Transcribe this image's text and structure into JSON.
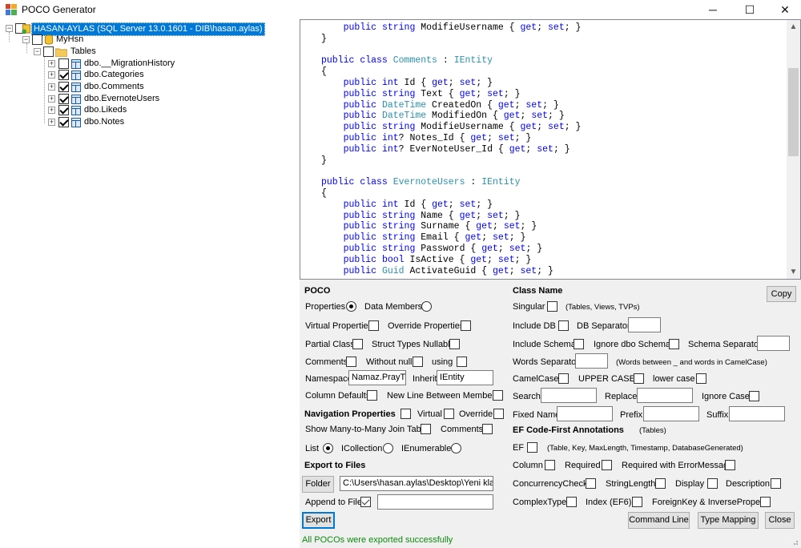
{
  "window": {
    "title": "POCO Generator",
    "minimize": "─",
    "maximize": "☐",
    "close": "✕"
  },
  "tree": {
    "server": "HASAN-AYLAS (SQL Server 13.0.1601 - DIB\\hasan.aylas)",
    "database": "MyHsn",
    "tables_folder": "Tables",
    "tables": [
      {
        "name": "dbo.__MigrationHistory",
        "checked": false
      },
      {
        "name": "dbo.Categories",
        "checked": true
      },
      {
        "name": "dbo.Comments",
        "checked": true
      },
      {
        "name": "dbo.EvernoteUsers",
        "checked": true
      },
      {
        "name": "dbo.Likeds",
        "checked": true
      },
      {
        "name": "dbo.Notes",
        "checked": true
      }
    ]
  },
  "code_lines": [
    {
      "t": [
        [
          "    ",
          ""
        ],
        [
          "public",
          "kw"
        ],
        [
          " ",
          ""
        ],
        [
          "string",
          "kw"
        ],
        [
          " ModifieUsername { ",
          ""
        ],
        [
          "get",
          "kw"
        ],
        [
          "; ",
          ""
        ],
        [
          "set",
          "kw"
        ],
        [
          "; }",
          ""
        ]
      ]
    },
    {
      "t": [
        [
          "}",
          ""
        ]
      ]
    },
    {
      "t": [
        [
          "",
          ""
        ]
      ]
    },
    {
      "t": [
        [
          "public",
          "kw"
        ],
        [
          " ",
          ""
        ],
        [
          "class",
          "kw"
        ],
        [
          " ",
          ""
        ],
        [
          "Comments",
          "ty"
        ],
        [
          " : ",
          ""
        ],
        [
          "IEntity",
          "ty"
        ]
      ]
    },
    {
      "t": [
        [
          "{",
          ""
        ]
      ]
    },
    {
      "t": [
        [
          "    ",
          ""
        ],
        [
          "public",
          "kw"
        ],
        [
          " ",
          ""
        ],
        [
          "int",
          "kw"
        ],
        [
          " Id { ",
          ""
        ],
        [
          "get",
          "kw"
        ],
        [
          "; ",
          ""
        ],
        [
          "set",
          "kw"
        ],
        [
          "; }",
          ""
        ]
      ]
    },
    {
      "t": [
        [
          "    ",
          ""
        ],
        [
          "public",
          "kw"
        ],
        [
          " ",
          ""
        ],
        [
          "string",
          "kw"
        ],
        [
          " Text { ",
          ""
        ],
        [
          "get",
          "kw"
        ],
        [
          "; ",
          ""
        ],
        [
          "set",
          "kw"
        ],
        [
          "; }",
          ""
        ]
      ]
    },
    {
      "t": [
        [
          "    ",
          ""
        ],
        [
          "public",
          "kw"
        ],
        [
          " ",
          ""
        ],
        [
          "DateTime",
          "ty"
        ],
        [
          " CreatedOn { ",
          ""
        ],
        [
          "get",
          "kw"
        ],
        [
          "; ",
          ""
        ],
        [
          "set",
          "kw"
        ],
        [
          "; }",
          ""
        ]
      ]
    },
    {
      "t": [
        [
          "    ",
          ""
        ],
        [
          "public",
          "kw"
        ],
        [
          " ",
          ""
        ],
        [
          "DateTime",
          "ty"
        ],
        [
          " ModifiedOn { ",
          ""
        ],
        [
          "get",
          "kw"
        ],
        [
          "; ",
          ""
        ],
        [
          "set",
          "kw"
        ],
        [
          "; }",
          ""
        ]
      ]
    },
    {
      "t": [
        [
          "    ",
          ""
        ],
        [
          "public",
          "kw"
        ],
        [
          " ",
          ""
        ],
        [
          "string",
          "kw"
        ],
        [
          " ModifieUsername { ",
          ""
        ],
        [
          "get",
          "kw"
        ],
        [
          "; ",
          ""
        ],
        [
          "set",
          "kw"
        ],
        [
          "; }",
          ""
        ]
      ]
    },
    {
      "t": [
        [
          "    ",
          ""
        ],
        [
          "public",
          "kw"
        ],
        [
          " ",
          ""
        ],
        [
          "int",
          "kw"
        ],
        [
          "? Notes_Id { ",
          ""
        ],
        [
          "get",
          "kw"
        ],
        [
          "; ",
          ""
        ],
        [
          "set",
          "kw"
        ],
        [
          "; }",
          ""
        ]
      ]
    },
    {
      "t": [
        [
          "    ",
          ""
        ],
        [
          "public",
          "kw"
        ],
        [
          " ",
          ""
        ],
        [
          "int",
          "kw"
        ],
        [
          "? EverNoteUser_Id { ",
          ""
        ],
        [
          "get",
          "kw"
        ],
        [
          "; ",
          ""
        ],
        [
          "set",
          "kw"
        ],
        [
          "; }",
          ""
        ]
      ]
    },
    {
      "t": [
        [
          "}",
          ""
        ]
      ]
    },
    {
      "t": [
        [
          "",
          ""
        ]
      ]
    },
    {
      "t": [
        [
          "public",
          "kw"
        ],
        [
          " ",
          ""
        ],
        [
          "class",
          "kw"
        ],
        [
          " ",
          ""
        ],
        [
          "EvernoteUsers",
          "ty"
        ],
        [
          " : ",
          ""
        ],
        [
          "IEntity",
          "ty"
        ]
      ]
    },
    {
      "t": [
        [
          "{",
          ""
        ]
      ]
    },
    {
      "t": [
        [
          "    ",
          ""
        ],
        [
          "public",
          "kw"
        ],
        [
          " ",
          ""
        ],
        [
          "int",
          "kw"
        ],
        [
          " Id { ",
          ""
        ],
        [
          "get",
          "kw"
        ],
        [
          "; ",
          ""
        ],
        [
          "set",
          "kw"
        ],
        [
          "; }",
          ""
        ]
      ]
    },
    {
      "t": [
        [
          "    ",
          ""
        ],
        [
          "public",
          "kw"
        ],
        [
          " ",
          ""
        ],
        [
          "string",
          "kw"
        ],
        [
          " Name { ",
          ""
        ],
        [
          "get",
          "kw"
        ],
        [
          "; ",
          ""
        ],
        [
          "set",
          "kw"
        ],
        [
          "; }",
          ""
        ]
      ]
    },
    {
      "t": [
        [
          "    ",
          ""
        ],
        [
          "public",
          "kw"
        ],
        [
          " ",
          ""
        ],
        [
          "string",
          "kw"
        ],
        [
          " Surname { ",
          ""
        ],
        [
          "get",
          "kw"
        ],
        [
          "; ",
          ""
        ],
        [
          "set",
          "kw"
        ],
        [
          "; }",
          ""
        ]
      ]
    },
    {
      "t": [
        [
          "    ",
          ""
        ],
        [
          "public",
          "kw"
        ],
        [
          " ",
          ""
        ],
        [
          "string",
          "kw"
        ],
        [
          " Email { ",
          ""
        ],
        [
          "get",
          "kw"
        ],
        [
          "; ",
          ""
        ],
        [
          "set",
          "kw"
        ],
        [
          "; }",
          ""
        ]
      ]
    },
    {
      "t": [
        [
          "    ",
          ""
        ],
        [
          "public",
          "kw"
        ],
        [
          " ",
          ""
        ],
        [
          "string",
          "kw"
        ],
        [
          " Password { ",
          ""
        ],
        [
          "get",
          "kw"
        ],
        [
          "; ",
          ""
        ],
        [
          "set",
          "kw"
        ],
        [
          "; }",
          ""
        ]
      ]
    },
    {
      "t": [
        [
          "    ",
          ""
        ],
        [
          "public",
          "kw"
        ],
        [
          " ",
          ""
        ],
        [
          "bool",
          "kw"
        ],
        [
          " IsActive { ",
          ""
        ],
        [
          "get",
          "kw"
        ],
        [
          "; ",
          ""
        ],
        [
          "set",
          "kw"
        ],
        [
          "; }",
          ""
        ]
      ]
    },
    {
      "t": [
        [
          "    ",
          ""
        ],
        [
          "public",
          "kw"
        ],
        [
          " ",
          ""
        ],
        [
          "Guid",
          "ty"
        ],
        [
          " ActivateGuid { ",
          ""
        ],
        [
          "get",
          "kw"
        ],
        [
          "; ",
          ""
        ],
        [
          "set",
          "kw"
        ],
        [
          "; }",
          ""
        ]
      ]
    }
  ],
  "colors": {
    "keyword": "#0000ff",
    "type": "#2b91af",
    "status": "#0a8a0a",
    "selection": "#0078d7"
  },
  "poco": {
    "header": "POCO",
    "properties": "Properties",
    "data_members": "Data Members",
    "virtual_properties": "Virtual Properties",
    "override_properties": "Override Properties",
    "partial_class": "Partial Class",
    "struct_types_nullable": "Struct Types Nullable",
    "comments": "Comments",
    "without_null": "Without null",
    "using": "using",
    "namespace_label": "Namespace",
    "namespace_value": "Namaz.PrayTir",
    "inherit_label": "Inherit",
    "inherit_value": "IEntity",
    "column_defaults": "Column Defaults",
    "new_line_between_members": "New Line Between Members"
  },
  "navigation": {
    "header": "Navigation Properties",
    "virtual": "Virtual",
    "override": "Override",
    "show_many_to_many": "Show Many-to-Many Join Table",
    "comments": "Comments",
    "list": "List",
    "icollection": "ICollection",
    "ienumerable": "IEnumerable"
  },
  "export": {
    "header": "Export to Files",
    "folder_button": "Folder",
    "folder_path": "C:\\Users\\hasan.aylas\\Desktop\\Yeni klasör",
    "append_to_file": "Append to File",
    "append_value": "",
    "export_button": "Export"
  },
  "class_name": {
    "header": "Class Name",
    "copy_button": "Copy",
    "singular": "Singular",
    "singular_hint": "(Tables, Views, TVPs)",
    "include_db": "Include DB",
    "db_separator": "DB Separator",
    "include_schema": "Include Schema",
    "ignore_dbo_schema": "Ignore dbo Schema",
    "schema_separator": "Schema Separator",
    "words_separator": "Words Separator",
    "words_hint": "(Words between _ and words in CamelCase)",
    "camelcase": "CamelCase",
    "upper_case": "UPPER CASE",
    "lower_case": "lower case",
    "search": "Search",
    "replace": "Replace",
    "ignore_case": "Ignore Case",
    "fixed_name": "Fixed Name",
    "prefix": "Prefix",
    "suffix": "Suffix"
  },
  "ef": {
    "header": "EF Code-First Annotations",
    "header_hint": "(Tables)",
    "ef": "EF",
    "ef_hint": "(Table, Key, MaxLength, Timestamp, DatabaseGenerated)",
    "column": "Column",
    "required": "Required",
    "required_with_error": "Required with ErrorMessage",
    "concurrency_check": "ConcurrencyCheck",
    "string_length": "StringLength",
    "display": "Display",
    "description": "Description",
    "complex_type": "ComplexType",
    "index_ef6": "Index (EF6)",
    "foreignkey_inverse": "ForeignKey & InverseProperty"
  },
  "buttons": {
    "command_line": "Command Line",
    "type_mapping": "Type Mapping",
    "close": "Close"
  },
  "status": "All POCOs were exported successfully"
}
